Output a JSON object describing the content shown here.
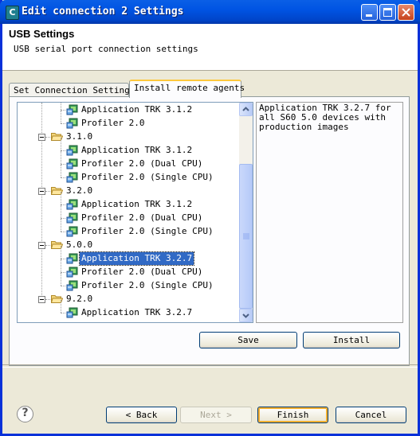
{
  "window": {
    "title": "Edit connection 2 Settings",
    "app_icon": "C"
  },
  "header": {
    "title": "USB Settings",
    "description": "USB serial port connection settings"
  },
  "tabs": [
    {
      "label": "Set Connection Settings",
      "active": false
    },
    {
      "label": "Install remote agents",
      "active": true
    }
  ],
  "tree": {
    "nodes": [
      {
        "type": "agent",
        "label": "Application TRK 3.1.2",
        "level": 2
      },
      {
        "type": "agent",
        "label": "Profiler 2.0",
        "level": 2
      },
      {
        "type": "folder",
        "label": "3.1.0",
        "level": 1,
        "expanded": true
      },
      {
        "type": "agent",
        "label": "Application TRK 3.1.2",
        "level": 2
      },
      {
        "type": "agent",
        "label": "Profiler 2.0 (Dual CPU)",
        "level": 2
      },
      {
        "type": "agent",
        "label": "Profiler 2.0 (Single CPU)",
        "level": 2
      },
      {
        "type": "folder",
        "label": "3.2.0",
        "level": 1,
        "expanded": true
      },
      {
        "type": "agent",
        "label": "Application TRK 3.1.2",
        "level": 2
      },
      {
        "type": "agent",
        "label": "Profiler 2.0 (Dual CPU)",
        "level": 2
      },
      {
        "type": "agent",
        "label": "Profiler 2.0 (Single CPU)",
        "level": 2
      },
      {
        "type": "folder",
        "label": "5.0.0",
        "level": 1,
        "expanded": true
      },
      {
        "type": "agent",
        "label": "Application TRK 3.2.7",
        "level": 2,
        "selected": true
      },
      {
        "type": "agent",
        "label": "Profiler 2.0 (Dual CPU)",
        "level": 2
      },
      {
        "type": "agent",
        "label": "Profiler 2.0 (Single CPU)",
        "level": 2
      },
      {
        "type": "folder",
        "label": "9.2.0",
        "level": 1,
        "expanded": true
      },
      {
        "type": "agent",
        "label": "Application TRK 3.2.7",
        "level": 2
      }
    ]
  },
  "description_panel": {
    "text": "Application TRK 3.2.7 for all S60 5.0 devices with production images"
  },
  "actions": {
    "save": "Save",
    "install": "Install"
  },
  "footer": {
    "help": "?",
    "back": "< Back",
    "next": "Next >",
    "finish": "Finish",
    "cancel": "Cancel"
  },
  "colors": {
    "title_bar": "#0054e3",
    "selection": "#316ac5",
    "tab_highlight": "#ffc83c"
  },
  "icons": {
    "agent": "agent-package-icon",
    "folder": "open-folder-icon",
    "help": "help-icon"
  }
}
